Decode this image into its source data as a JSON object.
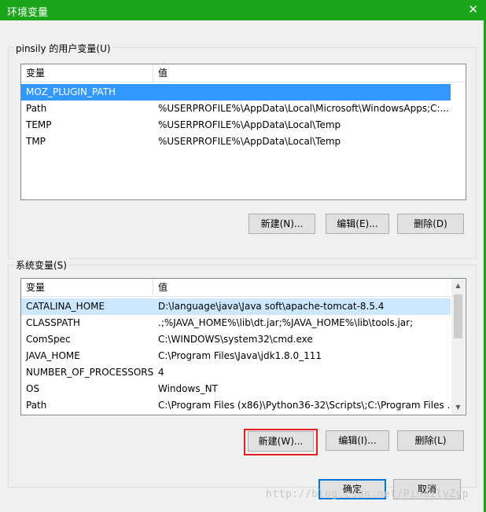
{
  "window": {
    "title": "环境变量",
    "close_icon": "close-icon"
  },
  "user_vars": {
    "group_label": "pinsily 的用户变量(U)",
    "columns": [
      "变量",
      "值"
    ],
    "rows": [
      {
        "name": "MOZ_PLUGIN_PATH",
        "value": ""
      },
      {
        "name": "Path",
        "value": "%USERPROFILE%\\AppData\\Local\\Microsoft\\WindowsApps;C:..."
      },
      {
        "name": "TEMP",
        "value": "%USERPROFILE%\\AppData\\Local\\Temp"
      },
      {
        "name": "TMP",
        "value": "%USERPROFILE%\\AppData\\Local\\Temp"
      }
    ],
    "buttons": {
      "new": "新建(N)...",
      "edit": "编辑(E)...",
      "delete": "删除(D)"
    }
  },
  "system_vars": {
    "group_label": "系统变量(S)",
    "columns": [
      "变量",
      "值"
    ],
    "rows": [
      {
        "name": "CATALINA_HOME",
        "value": "D:\\language\\java\\Java soft\\apache-tomcat-8.5.4"
      },
      {
        "name": "CLASSPATH",
        "value": ".;%JAVA_HOME%\\lib\\dt.jar;%JAVA_HOME%\\lib\\tools.jar;"
      },
      {
        "name": "ComSpec",
        "value": "C:\\WINDOWS\\system32\\cmd.exe"
      },
      {
        "name": "JAVA_HOME",
        "value": "C:\\Program Files\\Java\\jdk1.8.0_111"
      },
      {
        "name": "NUMBER_OF_PROCESSORS",
        "value": "4"
      },
      {
        "name": "OS",
        "value": "Windows_NT"
      },
      {
        "name": "Path",
        "value": "C:\\Program Files (x86)\\Python36-32\\Scripts\\;C:\\Program Files ..."
      }
    ],
    "buttons": {
      "new": "新建(W)...",
      "edit": "编辑(I)...",
      "delete": "删除(L)"
    }
  },
  "footer": {
    "ok": "确定",
    "cancel": "取消"
  },
  "watermark": "http://blog.csdn.net/PinsilyZyp",
  "colors": {
    "titlebar": "#1aa51a",
    "selection": "#3399ff",
    "hover_row": "#cce8ff",
    "highlight_box": "#e02020"
  }
}
